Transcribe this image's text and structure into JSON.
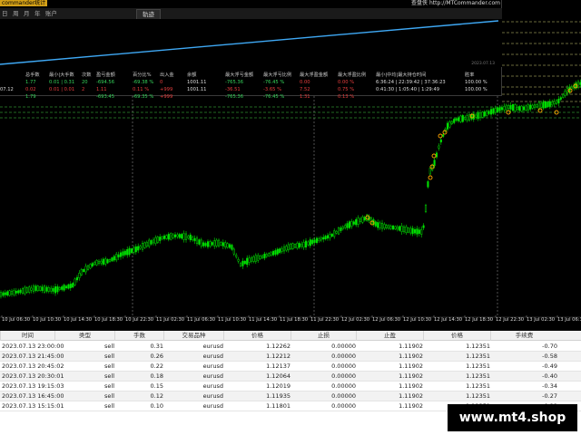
{
  "window": {
    "title": "commander统计",
    "brand_right": "查盘侠 http://MTCommander.com"
  },
  "menu": {
    "items": [
      "日",
      "周",
      "月",
      "年",
      "账户"
    ],
    "active_tab": "轨迹"
  },
  "equity_curve_date": "2023.07.13",
  "stats": {
    "headers": [
      "总手数",
      "最小|大手数",
      "次数",
      "盈亏金额",
      "百分比%",
      "出入金",
      "余额",
      "最大浮亏金额",
      "最大浮亏比例",
      "最大浮盈金额",
      "最大浮盈比例",
      "最小|中均|最大持仓时间",
      "胜率"
    ],
    "rows": [
      {
        "left": "",
        "values": [
          "1.77",
          "0.01 | 0.31",
          "20",
          "-694.56",
          "-69.38 %",
          "0",
          "1001.11",
          "-765.36",
          "-76.45 %",
          "0.00",
          "0.00 %",
          "6:36:24 | 22:39:42 | 37:36:23",
          "100.00 %"
        ],
        "tone": "green"
      },
      {
        "left": "07.12",
        "values": [
          "0.02",
          "0.01 | 0.01",
          "2",
          "1.11",
          "0.11 %",
          "+999",
          "1001.11",
          "-36.51",
          "-3.65 %",
          "7.52",
          "0.75 %",
          "0:41:30 | 1:05:40 | 1:29:49",
          "100.00 %"
        ],
        "tone": "red"
      },
      {
        "left": "",
        "values": [
          "1.79",
          "",
          "",
          "-693.45",
          "-69.35 %",
          "+999",
          "",
          "-765.36",
          "-76.45 %",
          "1.31",
          "0.13 %",
          "",
          ""
        ],
        "tone": "green"
      }
    ]
  },
  "x_ticks": [
    "10 Jul 06:30",
    "10 Jul 10:30",
    "10 Jul 14:30",
    "10 Jul 18:30",
    "10 Jul 22:30",
    "11 Jul 02:30",
    "11 Jul 06:30",
    "11 Jul 10:30",
    "11 Jul 14:30",
    "11 Jul 18:30",
    "11 Jul 22:30",
    "12 Jul 02:30",
    "12 Jul 06:30",
    "12 Jul 10:30",
    "12 Jul 14:30",
    "12 Jul 18:30",
    "12 Jul 22:30",
    "13 Jul 02:30",
    "13 Jul 06:30"
  ],
  "table": {
    "headers": [
      "时间",
      "类型",
      "手数",
      "交易品种",
      "价格",
      "止损",
      "止盈",
      "价格",
      "手续费"
    ],
    "rows": [
      [
        "2023.07.13 23:00:00",
        "sell",
        "0.31",
        "eurusd",
        "1.12262",
        "0.00000",
        "1.11902",
        "1.12351",
        "-0.70"
      ],
      [
        "2023.07.13 21:45:00",
        "sell",
        "0.26",
        "eurusd",
        "1.12212",
        "0.00000",
        "1.11902",
        "1.12351",
        "-0.58"
      ],
      [
        "2023.07.13 20:45:02",
        "sell",
        "0.22",
        "eurusd",
        "1.12137",
        "0.00000",
        "1.11902",
        "1.12351",
        "-0.49"
      ],
      [
        "2023.07.13 20:30:01",
        "sell",
        "0.18",
        "eurusd",
        "1.12064",
        "0.00000",
        "1.11902",
        "1.12351",
        "-0.40"
      ],
      [
        "2023.07.13 19:15:03",
        "sell",
        "0.15",
        "eurusd",
        "1.12019",
        "0.00000",
        "1.11902",
        "1.12351",
        "-0.34"
      ],
      [
        "2023.07.13 16:45:00",
        "sell",
        "0.12",
        "eurusd",
        "1.11935",
        "0.00000",
        "1.11902",
        "1.12351",
        "-0.27"
      ],
      [
        "2023.07.13 15:15:01",
        "sell",
        "0.10",
        "eurusd",
        "1.11801",
        "0.00000",
        "1.11902",
        "1.12351",
        "-0.22"
      ]
    ]
  },
  "watermark": "www.mt4.shop",
  "colors": {
    "candle": "#00e000",
    "equity_line": "#3fa9f5",
    "grid_dash": "#d4d47a",
    "level_dash": "#2e8b2e"
  }
}
